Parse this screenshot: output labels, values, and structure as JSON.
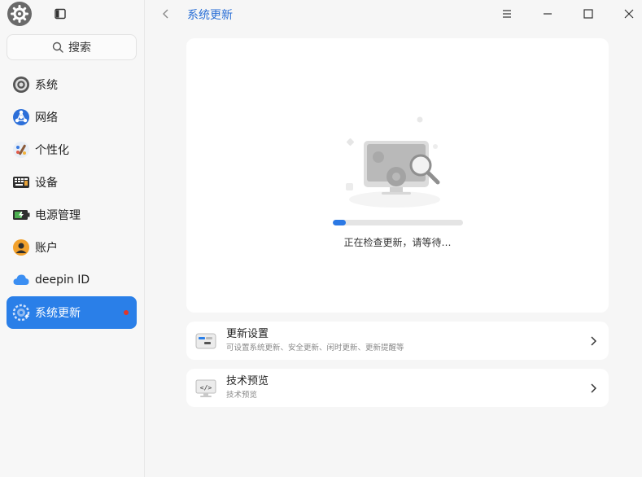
{
  "sidebar": {
    "search_label": "搜索",
    "items": [
      {
        "label": "系统",
        "icon": "system-gear-icon"
      },
      {
        "label": "网络",
        "icon": "network-icon"
      },
      {
        "label": "个性化",
        "icon": "personalization-icon"
      },
      {
        "label": "设备",
        "icon": "device-icon"
      },
      {
        "label": "电源管理",
        "icon": "battery-icon"
      },
      {
        "label": "账户",
        "icon": "account-icon"
      },
      {
        "label": "deepin ID",
        "icon": "cloud-icon"
      },
      {
        "label": "系统更新",
        "icon": "update-gear-icon",
        "active": true,
        "has_notification": true
      }
    ]
  },
  "header": {
    "title": "系统更新"
  },
  "main": {
    "status_text": "正在检查更新，请等待…",
    "progress": 0.1,
    "settings": [
      {
        "title": "更新设置",
        "subtitle": "可设置系统更新、安全更新、闲时更新、更新提醒等",
        "icon": "update-settings-icon"
      },
      {
        "title": "技术预览",
        "subtitle": "技术预览",
        "icon": "code-preview-icon"
      }
    ]
  },
  "colors": {
    "accent": "#2a7fe8",
    "notification": "#e0362b",
    "title": "#2a6fd6"
  }
}
